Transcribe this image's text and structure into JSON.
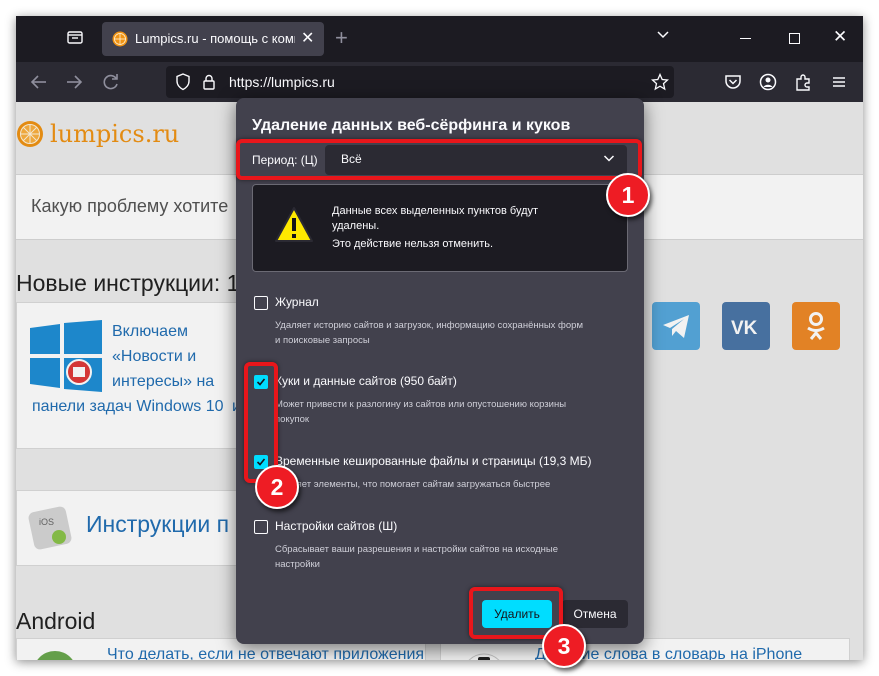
{
  "colors": {
    "browser_dark": "#1c1b22",
    "toolbar": "#2b2a33",
    "dialog_bg": "#42414d",
    "accent": "#00ddff",
    "annotation_red": "#e8161b",
    "logo_orange": "#f09314"
  },
  "browser": {
    "tab_title": "Lumpics.ru - помощь с компь",
    "url": "https://lumpics.ru",
    "icons": [
      "tab-list-icon",
      "close-icon",
      "plus-icon",
      "chevron-down-icon",
      "back-arrow-icon",
      "forward-arrow-icon",
      "reload-icon",
      "shield-icon",
      "lock-icon",
      "star-icon",
      "pocket-icon",
      "account-icon",
      "extensions-icon",
      "menu-icon"
    ]
  },
  "page": {
    "logo_text": "lumpics.ru",
    "search_placeholder": "Какую проблему хотите",
    "new_instructions_heading": "Новые инструкции: 1",
    "article1_lines": [
      "Включаем",
      "«Новости и",
      "интересы» на",
      "панели задач Windows 10"
    ],
    "article1_extra": "и",
    "ios_section": "Инструкции п",
    "android_heading": "Android",
    "article_bottom_left": "Что делать, если не отвечают приложения",
    "article_bottom_right": "До... ние слова в словарь на iPhone"
  },
  "dialog": {
    "title": "Удаление данных веб-сёрфинга и куков",
    "period_label": "Период: (Ц)",
    "period_value": "Всё",
    "warning_line1": "Данные всех выделенных пунктов будут",
    "warning_line2": "удалены.",
    "warning_line3": "Это действие нельзя отменить.",
    "options": [
      {
        "label": "Журнал",
        "checked": false,
        "desc_line1": "Удаляет историю сайтов и загрузок, информацию сохранённых форм",
        "desc_line2": "и поисковые запросы"
      },
      {
        "label": "Куки и данные сайтов (950 байт)",
        "checked": true,
        "desc_line1": "Может привести к разлогину из сайтов или опустошению корзины",
        "desc_line2": "покупок"
      },
      {
        "label": "Временные кешированные файлы и страницы (19,3 МБ)",
        "checked": true,
        "desc_line1": "Удаляет элементы, что помогает сайтам загружаться быстрее",
        "desc_line2": ""
      },
      {
        "label": "Настройки сайтов (Ш)",
        "checked": false,
        "desc_line1": "Сбрасывает ваши разрешения и настройки сайтов на исходные",
        "desc_line2": "настройки"
      }
    ],
    "delete_button": "Удалить",
    "cancel_button": "Отмена"
  },
  "annotations": {
    "badge1": "1",
    "badge2": "2",
    "badge3": "3"
  }
}
